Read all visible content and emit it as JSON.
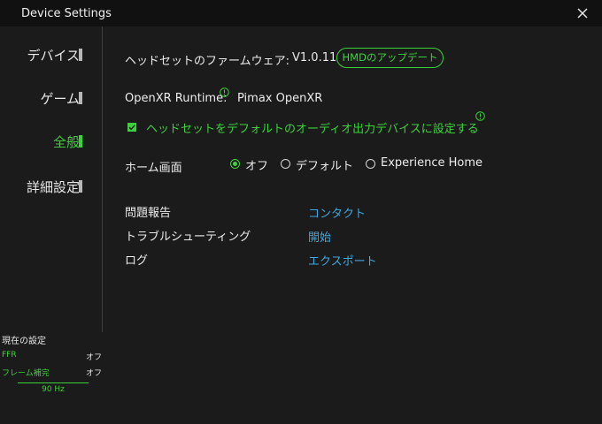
{
  "window": {
    "title": "Device Settings",
    "close_icon": "close-icon"
  },
  "sidebar": {
    "items": [
      {
        "label": "デバイス",
        "active": false
      },
      {
        "label": "ゲーム",
        "active": false
      },
      {
        "label": "全般",
        "active": true
      },
      {
        "label": "詳細設定",
        "active": false
      }
    ]
  },
  "status_panel": {
    "heading": "現在の設定",
    "rows": [
      {
        "key": "FFR",
        "value": "オフ"
      },
      {
        "key": "フレーム補完",
        "value": "オフ"
      }
    ],
    "refresh_rate": "90 Hz"
  },
  "general": {
    "firmware_label": "ヘッドセットのファームウェア:",
    "firmware_version": "V1.0.11",
    "update_button": "HMDのアップデート",
    "openxr_label": "OpenXR Runtime:",
    "openxr_value": "Pimax OpenXR",
    "default_audio": {
      "label": "ヘッドセットをデフォルトのオーディオ出力デバイスに設定する",
      "checked": true
    },
    "home_screen": {
      "label": "ホーム画面",
      "options": [
        "オフ",
        "デフォルト",
        "Experience Home"
      ],
      "selected": "オフ"
    },
    "support": [
      {
        "label": "問題報告",
        "action": "コンタクト"
      },
      {
        "label": "トラブルシューティング",
        "action": "開始"
      },
      {
        "label": "ログ",
        "action": "エクスポート"
      }
    ]
  },
  "colors": {
    "accent_green": "#3bd13b",
    "link_blue": "#3fa7e0",
    "background": "#1b1b1b",
    "titlebar": "#111111"
  }
}
